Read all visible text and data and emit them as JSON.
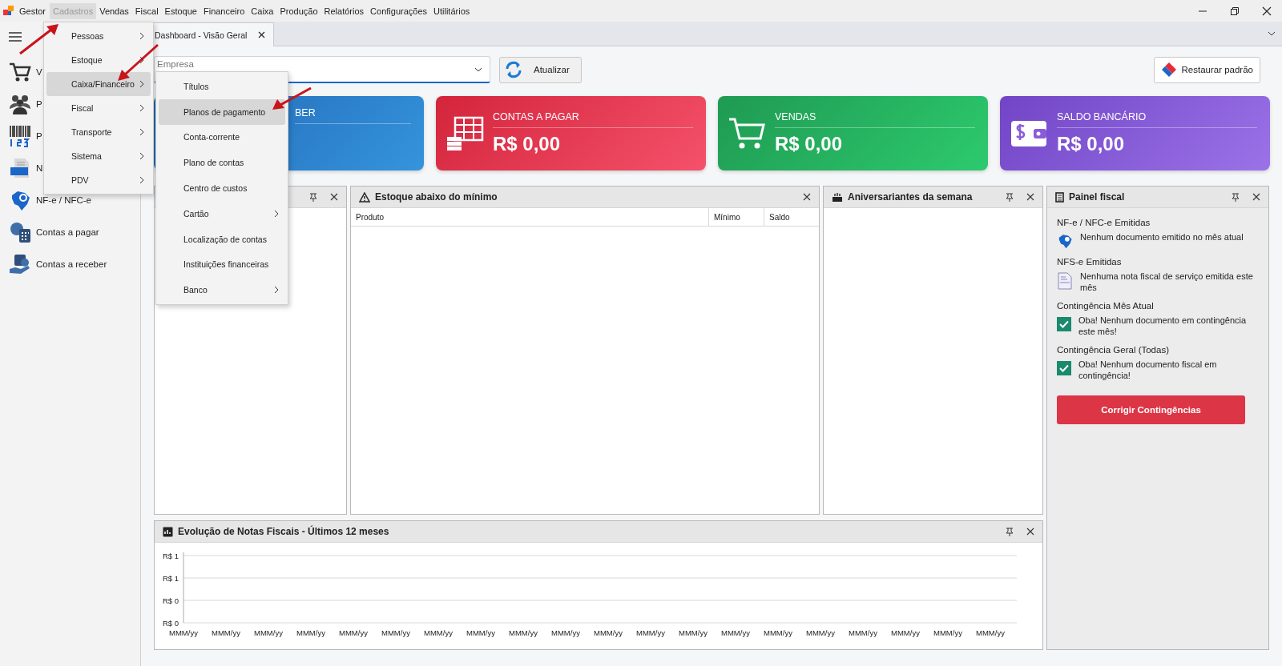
{
  "menu_bar": {
    "app": "Gestor",
    "items": [
      {
        "label": "Cadastros",
        "selected": true
      },
      {
        "label": "Vendas",
        "selected": false
      },
      {
        "label": "Fiscal",
        "selected": false
      },
      {
        "label": "Estoque",
        "selected": false
      },
      {
        "label": "Financeiro",
        "selected": false
      },
      {
        "label": "Caixa",
        "selected": false
      },
      {
        "label": "Produção",
        "selected": false
      },
      {
        "label": "Relatórios",
        "selected": false
      },
      {
        "label": "Configurações",
        "selected": false
      },
      {
        "label": "Utilitários",
        "selected": false
      }
    ]
  },
  "cadastros_menu": [
    {
      "label": "Pessoas",
      "selected": false
    },
    {
      "label": "Estoque",
      "selected": false
    },
    {
      "label": "Caixa/Financeiro",
      "selected": true
    },
    {
      "label": "Fiscal",
      "selected": false
    },
    {
      "label": "Transporte",
      "selected": false
    },
    {
      "label": "Sistema",
      "selected": false
    },
    {
      "label": "PDV",
      "selected": false
    }
  ],
  "submenu": [
    {
      "label": "Títulos",
      "selected": false,
      "submenu": false
    },
    {
      "label": "Planos de pagamento",
      "selected": true,
      "submenu": false
    },
    {
      "label": "Conta-corrente",
      "selected": false,
      "submenu": false
    },
    {
      "label": "Plano de contas",
      "selected": false,
      "submenu": false
    },
    {
      "label": "Centro de custos",
      "selected": false,
      "submenu": false
    },
    {
      "label": "Cartão",
      "selected": false,
      "submenu": true
    },
    {
      "label": "Localização de contas",
      "selected": false,
      "submenu": false
    },
    {
      "label": "Instituições financeiras",
      "selected": false,
      "submenu": false
    },
    {
      "label": "Banco",
      "selected": false,
      "submenu": true
    }
  ],
  "sidebar": {
    "items": [
      {
        "kind": "cart",
        "label": "V"
      },
      {
        "kind": "people",
        "label": "P"
      },
      {
        "kind": "barcode",
        "label": "P"
      },
      {
        "kind": "nfse",
        "label": "N"
      },
      {
        "kind": "nfe",
        "label": "NF-e / NFC-e"
      },
      {
        "kind": "payable",
        "label": "Contas a pagar"
      },
      {
        "kind": "receivable",
        "label": "Contas a receber"
      }
    ]
  },
  "tabs": [
    {
      "label": "Dashboard - Visão Geral",
      "selected": true
    }
  ],
  "toolbar": {
    "company_placeholder": "Empresa",
    "refresh": "Atualizar",
    "restore": "Restaurar padrão"
  },
  "cards": [
    {
      "kind": "receivable",
      "title": "BER"
    },
    {
      "kind": "payable",
      "title": "CONTAS A PAGAR",
      "value": "R$ 0,00"
    },
    {
      "kind": "sales",
      "title": "VENDAS",
      "value": "R$ 0,00"
    },
    {
      "kind": "bank",
      "title": "SALDO BANCÁRIO",
      "value": "R$ 0,00"
    }
  ],
  "panels": [
    {
      "kind": "blank",
      "pin": true
    },
    {
      "kind": "stock",
      "title": "Estoque abaixo do mínimo",
      "pin": false,
      "columns": [
        "Produto",
        "Mínimo",
        "Saldo"
      ]
    },
    {
      "kind": "birthdays",
      "title": "Aniversariantes da semana",
      "pin": true
    }
  ],
  "fiscal_panel": {
    "title": "Painel fiscal",
    "pin": true,
    "sections": [
      {
        "heading": "NF-e / NFC-e Emitidas",
        "kind": "nfe",
        "text": "Nenhum documento emitido no mês atual"
      },
      {
        "heading": "NFS-e Emitidas",
        "kind": "nfse",
        "text": "Nenhuma nota fiscal de serviço emitida este mês"
      },
      {
        "heading": "Contingência Mês Atual",
        "kind": "check",
        "checked": true,
        "text": "Oba! Nenhum documento em contingência este mês!"
      },
      {
        "heading": "Contingência Geral (Todas)",
        "kind": "check",
        "checked": true,
        "text": "Oba! Nenhum documento fiscal em contingência!"
      }
    ],
    "button": "Corrigir Contingências"
  },
  "chart_panel": {
    "title": "Evolução de Notas Fiscais - Últimos 12 meses",
    "pin": true,
    "y_labels": [
      "R$ 1",
      "R$ 1",
      "R$ 0",
      "R$ 0"
    ],
    "x_labels": [
      "MMM/yy",
      "MMM/yy",
      "MMM/yy",
      "MMM/yy",
      "MMM/yy",
      "MMM/yy",
      "MMM/yy",
      "MMM/yy",
      "MMM/yy",
      "MMM/yy",
      "MMM/yy",
      "MMM/yy",
      "MMM/yy",
      "MMM/yy",
      "MMM/yy",
      "MMM/yy",
      "MMM/yy",
      "MMM/yy",
      "MMM/yy",
      "MMM/yy"
    ]
  }
}
